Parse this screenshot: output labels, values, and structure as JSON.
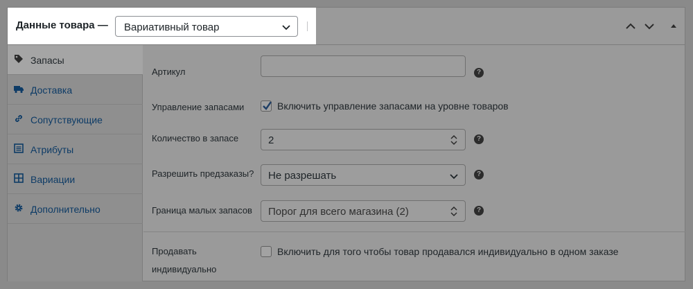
{
  "header": {
    "title": "Данные товара —",
    "product_type": "Вариативный товар"
  },
  "sidebar": {
    "items": [
      {
        "label": "Запасы",
        "icon": "tag-icon",
        "active": true
      },
      {
        "label": "Доставка",
        "icon": "truck-icon",
        "active": false
      },
      {
        "label": "Сопутствующие",
        "icon": "link-icon",
        "active": false
      },
      {
        "label": "Атрибуты",
        "icon": "list-icon",
        "active": false
      },
      {
        "label": "Вариации",
        "icon": "grid-icon",
        "active": false
      },
      {
        "label": "Дополнительно",
        "icon": "gear-icon",
        "active": false
      }
    ]
  },
  "form": {
    "sku": {
      "label": "Артикул",
      "value": ""
    },
    "manage_stock": {
      "label": "Управление запасами",
      "checkbox_label": "Включить управление запасами на уровне товаров",
      "checked": true
    },
    "stock_qty": {
      "label": "Количество в запасе",
      "value": "2"
    },
    "backorders": {
      "label": "Разрешить предзаказы?",
      "value": "Не разрешать"
    },
    "low_stock": {
      "label": "Граница малых запасов",
      "placeholder": "Порог для всего магазина (2)"
    },
    "sold_individually": {
      "label_line1": "Продавать",
      "label_line2": "индивидуально",
      "checkbox_label": "Включить для того чтобы товар продавался индивидуально в одном заказе",
      "checked": false
    }
  },
  "help_glyph": "?",
  "colors": {
    "link": "#0d3b66",
    "overlay": "#8a8a8a",
    "highlight": "#ffffff"
  }
}
